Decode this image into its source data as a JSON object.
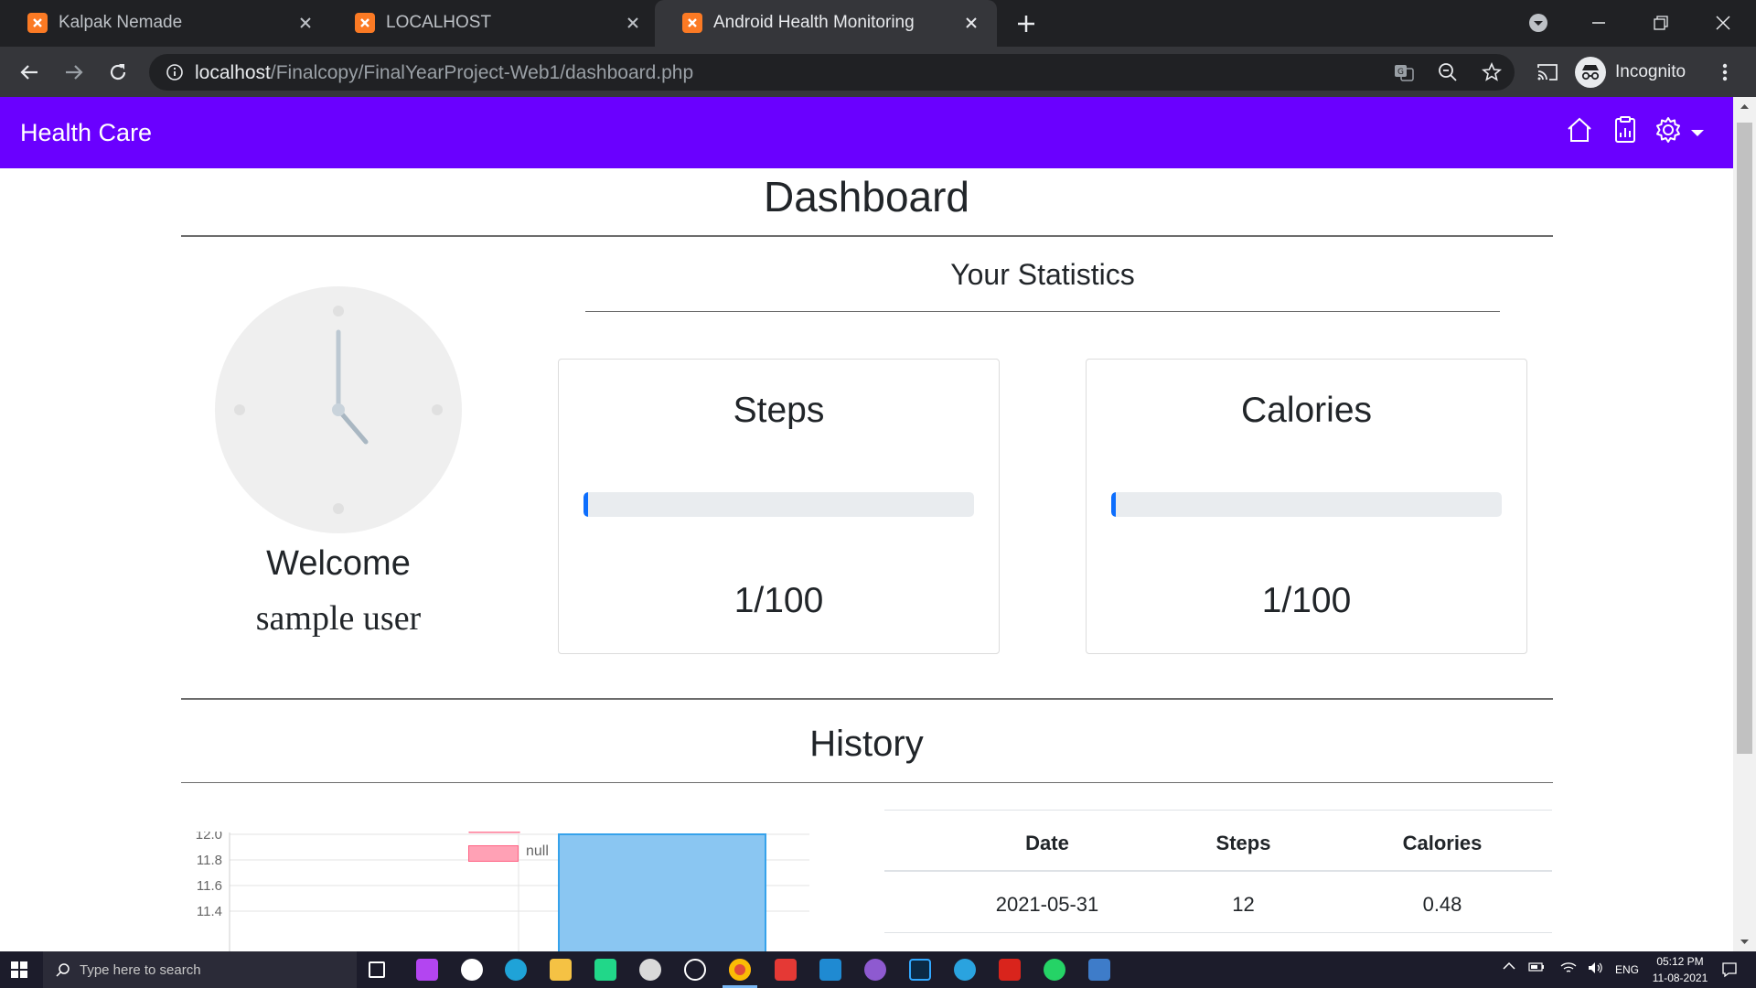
{
  "browser": {
    "tabs": [
      {
        "title": "Kalpak Nemade",
        "active": false
      },
      {
        "title": "LOCALHOST",
        "active": false
      },
      {
        "title": "Android Health Monitoring",
        "active": true
      }
    ],
    "url_host": "localhost",
    "url_path": "/Finalcopy/FinalYearProject-Web1/dashboard.php",
    "incognito_label": "Incognito"
  },
  "app": {
    "brand": "Health Care",
    "accent_color": "#6a00ff"
  },
  "dashboard": {
    "title": "Dashboard",
    "stats_heading": "Your Statistics",
    "welcome": "Welcome",
    "user": "sample user",
    "cards": [
      {
        "title": "Steps",
        "value": "1/100",
        "progress_fraction": 0.01
      },
      {
        "title": "Calories",
        "value": "1/100",
        "progress_fraction": 0.01
      }
    ],
    "history_title": "History"
  },
  "chart_data": {
    "type": "bar",
    "legend": [
      "null"
    ],
    "series": [
      {
        "name": "null",
        "values": [
          12
        ]
      }
    ],
    "y_ticks": [
      "12.0",
      "11.8",
      "11.6",
      "11.4"
    ],
    "ylim": [
      11.4,
      12.0
    ],
    "grid": true,
    "legend_position": "top",
    "colors": {
      "bar": "#8ac6f2",
      "bar_border": "#36a2eb",
      "legend_swatch": "#ffa1b5"
    }
  },
  "history_table": {
    "headers": [
      "Date",
      "Steps",
      "Calories"
    ],
    "rows": [
      [
        "2021-05-31",
        "12",
        "0.48"
      ]
    ]
  },
  "taskbar": {
    "search_placeholder": "Type here to search",
    "language": "ENG",
    "time": "05:12 PM",
    "date": "11-08-2021"
  }
}
